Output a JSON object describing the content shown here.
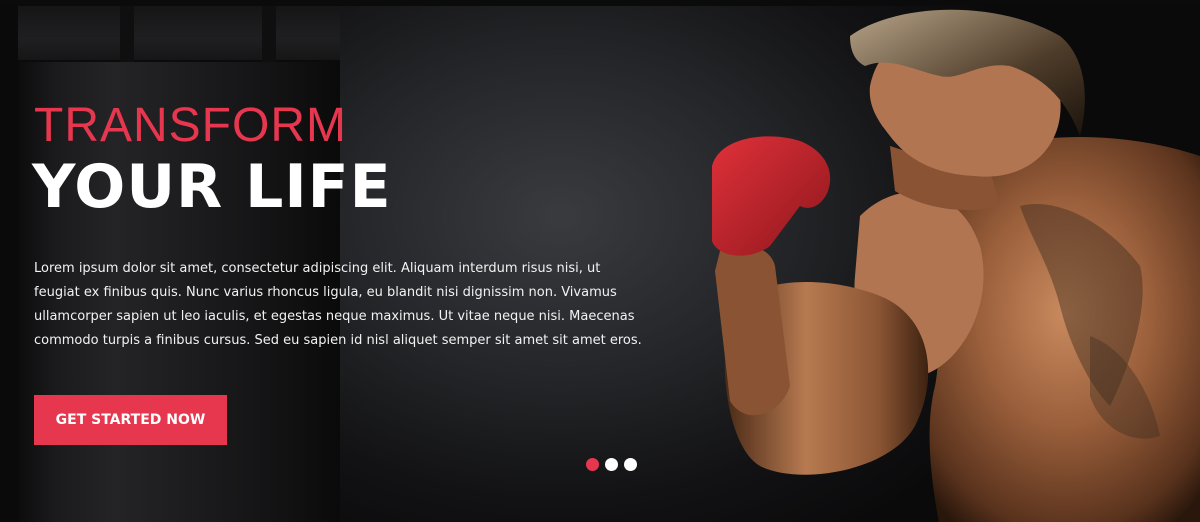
{
  "hero": {
    "title_line1": "TRANSFORM",
    "title_line2": "YOUR LIFE",
    "body": "Lorem ipsum dolor sit amet, consectetur adipiscing elit. Aliquam interdum risus nisi, ut feugiat ex finibus quis. Nunc varius rhoncus ligula, eu blandit nisi dignissim non. Vivamus ullamcorper sapien ut leo iaculis, et egestas neque maximus. Ut vitae neque nisi. Maecenas commodo turpis a finibus cursus. Sed eu sapien id nisl aliquet semper sit amet sit amet eros.",
    "cta_label": "GET STARTED NOW",
    "slider": {
      "total": 3,
      "active_index": 0
    }
  },
  "colors": {
    "accent": "#e6374f",
    "title_white": "#ffffff",
    "background": "#1e1f22"
  },
  "icons": [
    "punching-bag-image",
    "boxer-image"
  ]
}
